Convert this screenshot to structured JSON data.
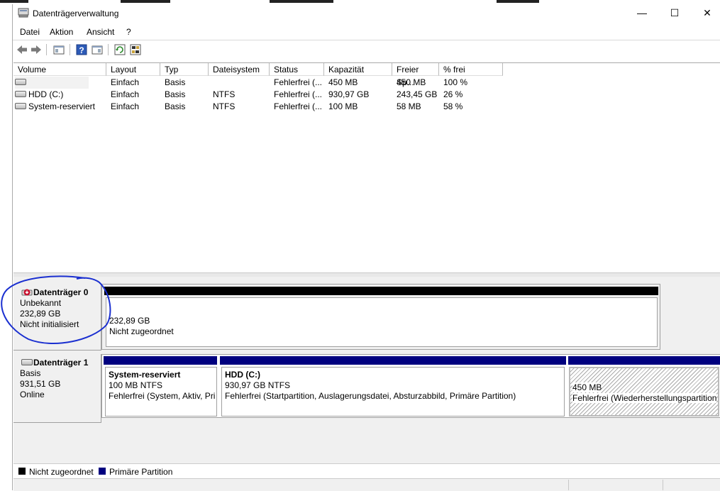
{
  "window": {
    "title": "Datenträgerverwaltung",
    "minimize_glyph": "—",
    "maximize_glyph": "☐",
    "close_glyph": "✕"
  },
  "menu": {
    "file": "Datei",
    "action": "Aktion",
    "view": "Ansicht",
    "help": "?"
  },
  "toolbar": {
    "icons": [
      "back-arrow-icon",
      "forward-arrow-icon",
      "show-hide-console-icon",
      "help-icon",
      "properties-icon",
      "refresh-icon",
      "settings-icon"
    ]
  },
  "volume_list": {
    "headers": [
      "Volume",
      "Layout",
      "Typ",
      "Dateisystem",
      "Status",
      "Kapazität",
      "Freier Sp...",
      "% frei"
    ],
    "rows": [
      {
        "volume": "",
        "layout": "Einfach",
        "type": "Basis",
        "fs": "",
        "status": "Fehlerfrei (...",
        "capacity": "450 MB",
        "free": "450 MB",
        "pct": "100 %"
      },
      {
        "volume": "HDD (C:)",
        "layout": "Einfach",
        "type": "Basis",
        "fs": "NTFS",
        "status": "Fehlerfrei (...",
        "capacity": "930,97 GB",
        "free": "243,45 GB",
        "pct": "26 %"
      },
      {
        "volume": "System-reserviert",
        "layout": "Einfach",
        "type": "Basis",
        "fs": "NTFS",
        "status": "Fehlerfrei (...",
        "capacity": "100 MB",
        "free": "58 MB",
        "pct": "58 %"
      }
    ]
  },
  "disks": [
    {
      "name": "Datenträger 0",
      "kind": "Unbekannt",
      "size": "232,89 GB",
      "state": "Nicht initialisiert",
      "partitions": [
        {
          "size": "232,89 GB",
          "label": "Nicht zugeordnet"
        }
      ]
    },
    {
      "name": "Datenträger 1",
      "kind": "Basis",
      "size": "931,51 GB",
      "state": "Online",
      "partitions": [
        {
          "title": "System-reserviert",
          "size": "100 MB NTFS",
          "status": "Fehlerfrei (System, Aktiv, Pri"
        },
        {
          "title": "HDD  (C:)",
          "size": "930,97 GB NTFS",
          "status": "Fehlerfrei (Startpartition, Auslagerungsdatei, Absturzabbild, Primäre Partition)"
        },
        {
          "size": "450 MB",
          "status": "Fehlerfrei (Wiederherstellungspartition"
        }
      ]
    }
  ],
  "legend": {
    "unallocated": "Nicht zugeordnet",
    "primary": "Primäre Partition"
  },
  "colors": {
    "unallocated": "#000000",
    "primary": "#00007f",
    "annotation": "#1a2fd0"
  }
}
